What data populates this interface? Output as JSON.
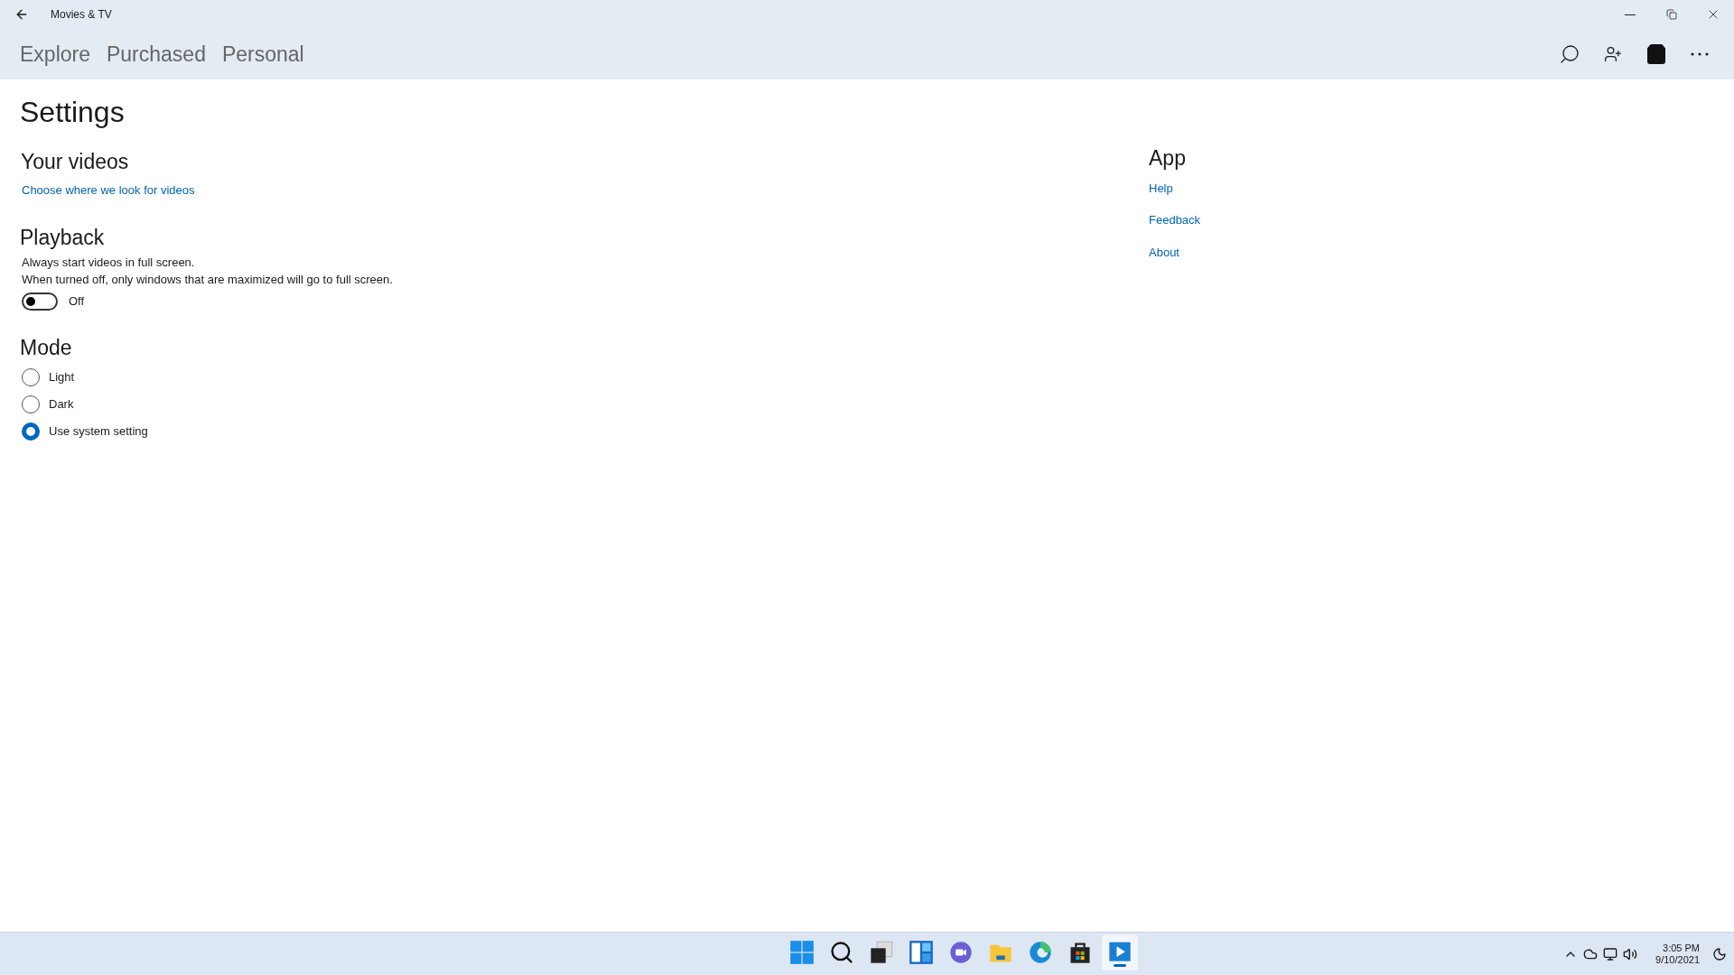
{
  "window": {
    "title": "Movies & TV"
  },
  "tabs": [
    {
      "label": "Explore",
      "selected": false
    },
    {
      "label": "Purchased",
      "selected": false
    },
    {
      "label": "Personal",
      "selected": false
    }
  ],
  "page_title": "Settings",
  "your_videos": {
    "heading": "Your videos",
    "link": "Choose where we look for videos"
  },
  "playback": {
    "heading": "Playback",
    "description": "Always start videos in full screen.",
    "note": "When turned off, only windows that are maximized will go to full screen.",
    "toggle": {
      "on": false,
      "label": "Off"
    }
  },
  "mode": {
    "heading": "Mode",
    "options": [
      {
        "label": "Light",
        "selected": false
      },
      {
        "label": "Dark",
        "selected": false
      },
      {
        "label": "Use system setting",
        "selected": true
      }
    ]
  },
  "app": {
    "heading": "App",
    "links": [
      "Help",
      "Feedback",
      "About"
    ]
  },
  "taskbar": {
    "apps": [
      {
        "kind": "start",
        "active": false
      },
      {
        "kind": "search",
        "active": false
      },
      {
        "kind": "taskview",
        "active": false
      },
      {
        "kind": "widgets",
        "active": false
      },
      {
        "kind": "chat",
        "active": false
      },
      {
        "kind": "explorer",
        "active": false
      },
      {
        "kind": "edge",
        "active": false
      },
      {
        "kind": "store",
        "active": false
      },
      {
        "kind": "movies",
        "active": true
      }
    ],
    "time": "3:05 PM",
    "date": "9/10/2021"
  }
}
